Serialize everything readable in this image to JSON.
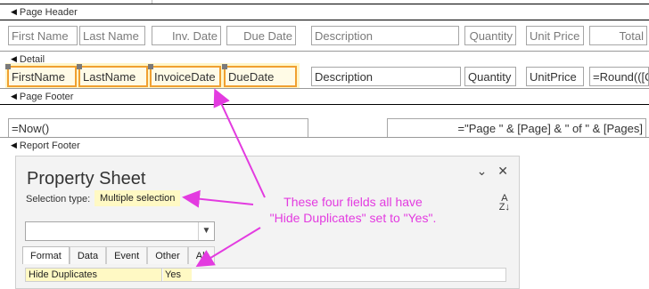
{
  "page_header": {
    "band_label": "Page Header",
    "labels": [
      "First Name",
      "Last Name",
      "Inv. Date",
      "Due Date",
      "Description",
      "Quantity",
      "Unit Price",
      "Total"
    ]
  },
  "detail": {
    "band_label": "Detail",
    "fields": [
      "FirstName",
      "LastName",
      "InvoiceDate",
      "DueDate",
      "Description",
      "Quantity",
      "UnitPrice",
      "=Round(([Q"
    ]
  },
  "page_footer": {
    "band_label": "Page Footer",
    "now": "=Now()",
    "pages": "=\"Page \" & [Page] & \" of \" & [Pages]"
  },
  "report_footer": {
    "band_label": "Report Footer"
  },
  "property_sheet": {
    "title": "Property Sheet",
    "selection_type_label": "Selection type:",
    "selection_type_value": "Multiple selection",
    "tabs": [
      "Format",
      "Data",
      "Event",
      "Other",
      "All"
    ],
    "active_tab": "Format",
    "property_name": "Hide Duplicates",
    "property_value": "Yes",
    "icons": [
      "chevron-down-icon",
      "close-icon",
      "sort-az-icon",
      "dropdown-arrow-icon"
    ]
  },
  "annotation": {
    "line1": "These four fields all have",
    "line2": "\"Hide Duplicates\" set to \"Yes\".",
    "color": "#e33be0"
  },
  "colors": {
    "selection_border": "#f0a030",
    "highlight": "#fff9c4"
  }
}
